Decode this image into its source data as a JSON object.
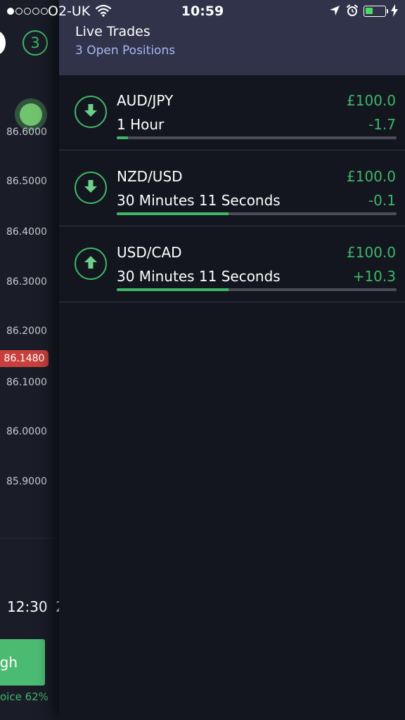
{
  "status_bar": {
    "signal_dots_filled": 1,
    "signal_dots_total": 5,
    "carrier": "O2-UK",
    "time": "10:59",
    "battery_level": 0.4
  },
  "background_chart": {
    "open_positions_count": "3",
    "y_axis_labels": [
      "86.6000",
      "86.5000",
      "86.4000",
      "86.3000",
      "86.2000",
      "86.1000",
      "86.0000",
      "85.9000"
    ],
    "current_price": "86.1480",
    "time_label": "12:30",
    "time_label_2": "2",
    "high_button_label": "gh",
    "payout_text": "oice 62%",
    "colors": {
      "accent_green": "#3fb767",
      "price_tag_red": "#c8403d"
    }
  },
  "live_trades": {
    "title": "Live Trades",
    "subtitle": "3 Open Positions",
    "trades": [
      {
        "pair": "AUD/JPY",
        "direction": "down",
        "direction_icon": "arrow-down-icon",
        "stake": "£100.0",
        "expiry": "1 Hour",
        "pnl": "-1.7",
        "progress": 0.04
      },
      {
        "pair": "NZD/USD",
        "direction": "down",
        "direction_icon": "arrow-down-icon",
        "stake": "£100.0",
        "expiry": "30 Minutes 11 Seconds",
        "pnl": "-0.1",
        "progress": 0.4
      },
      {
        "pair": "USD/CAD",
        "direction": "up",
        "direction_icon": "arrow-up-icon",
        "stake": "£100.0",
        "expiry": "30 Minutes 11 Seconds",
        "pnl": "+10.3",
        "progress": 0.4
      }
    ]
  }
}
